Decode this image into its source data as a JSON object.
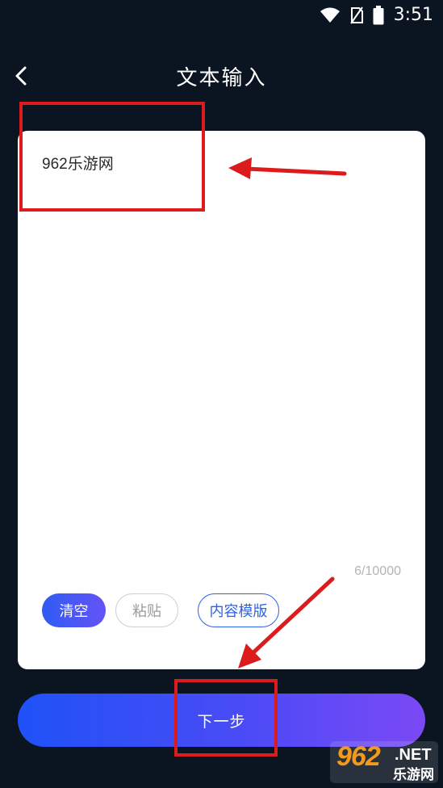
{
  "status_bar": {
    "time": "3:51"
  },
  "header": {
    "title": "文本输入",
    "back_icon": "chevron-left-icon"
  },
  "editor": {
    "text_value": "962乐游网",
    "char_count": "6/10000"
  },
  "actions": {
    "clear_label": "清空",
    "paste_label": "粘贴",
    "template_label": "内容模版"
  },
  "footer": {
    "next_label": "下一步"
  },
  "watermark": {
    "brand_num": "962",
    "brand_net": ".NET",
    "brand_sub": "乐游网"
  },
  "colors": {
    "background": "#0b1522",
    "accent_blue": "#2d63e8",
    "gradient_start": "#1f52f7",
    "gradient_end": "#7b49f5",
    "annotation_red": "#dc1c1c"
  }
}
